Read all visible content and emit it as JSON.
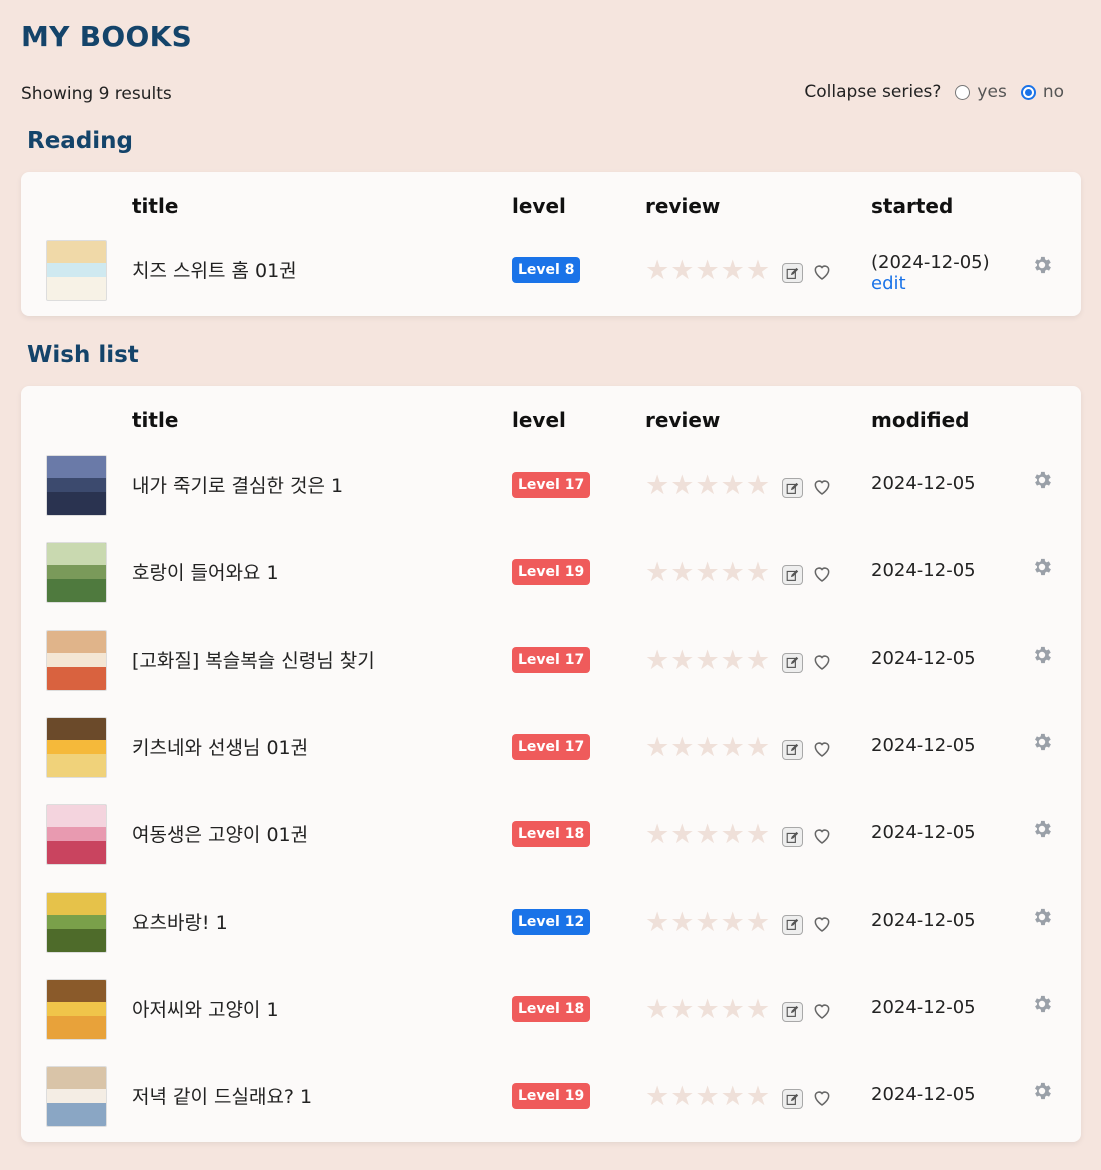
{
  "page": {
    "title": "MY BOOKS",
    "results_text": "Showing 9 results",
    "collapse": {
      "label": "Collapse series?",
      "yes_label": "yes",
      "no_label": "no",
      "selected": "no"
    }
  },
  "colors": {
    "accent": "#14446a",
    "link": "#1a73e8",
    "badge_blue": "#1a73e8",
    "badge_red": "#ef5b5b"
  },
  "reading": {
    "title": "Reading",
    "headers": {
      "title": "title",
      "level": "level",
      "review": "review",
      "date": "started"
    },
    "rows": [
      {
        "title": "치즈 스위트 홈 01권",
        "level": "Level 8",
        "level_color": "blue",
        "stars": 0,
        "date": "(2024-12-05)",
        "edit_label": "edit"
      }
    ]
  },
  "wishlist": {
    "title": "Wish list",
    "headers": {
      "title": "title",
      "level": "level",
      "review": "review",
      "date": "modified"
    },
    "rows": [
      {
        "title": "내가 죽기로 결심한 것은 1",
        "level": "Level 17",
        "level_color": "red",
        "stars": 0,
        "date": "2024-12-05"
      },
      {
        "title": "호랑이 들어와요 1",
        "level": "Level 19",
        "level_color": "red",
        "stars": 0,
        "date": "2024-12-05"
      },
      {
        "title": "[고화질] 복슬복슬 신령님 찾기",
        "level": "Level 17",
        "level_color": "red",
        "stars": 0,
        "date": "2024-12-05"
      },
      {
        "title": "키츠네와 선생님 01권",
        "level": "Level 17",
        "level_color": "red",
        "stars": 0,
        "date": "2024-12-05"
      },
      {
        "title": "여동생은 고양이 01권",
        "level": "Level 18",
        "level_color": "red",
        "stars": 0,
        "date": "2024-12-05"
      },
      {
        "title": "요츠바랑! 1",
        "level": "Level 12",
        "level_color": "blue",
        "stars": 0,
        "date": "2024-12-05"
      },
      {
        "title": "아저씨와 고양이 1",
        "level": "Level 18",
        "level_color": "red",
        "stars": 0,
        "date": "2024-12-05"
      },
      {
        "title": "저녁 같이 드실래요? 1",
        "level": "Level 19",
        "level_color": "red",
        "stars": 0,
        "date": "2024-12-05"
      }
    ]
  }
}
